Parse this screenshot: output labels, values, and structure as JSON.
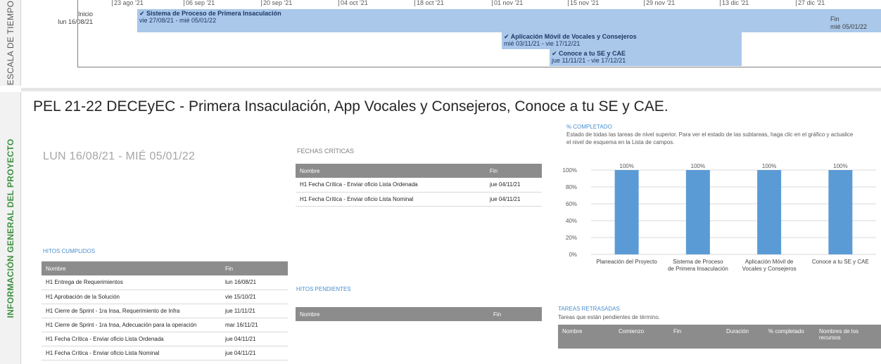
{
  "side_labels": {
    "timescale": "ESCALA DE TIEMPO",
    "info": "INFORMACIÓN GENERAL DEL PROYECTO"
  },
  "timeline": {
    "ticks": [
      "23 ago '21",
      "06 sep '21",
      "20 sep '21",
      "04 oct '21",
      "18 oct '21",
      "01 nov '21",
      "15 nov '21",
      "29 nov '21",
      "13 dic '21",
      "27 dic '21"
    ],
    "start_label": "Inicio",
    "start_date": "lun 16/08/21",
    "end_label": "Fin",
    "end_date": "mié 05/01/22",
    "bars": [
      {
        "title": "✔ Sistema de Proceso de Primera Insaculación",
        "dates": "vie 27/08/21 - mié 05/01/22"
      },
      {
        "title": "✔ Aplicación Móvil de Vocales y Consejeros",
        "dates": "mié 03/11/21 - vie 17/12/21"
      },
      {
        "title": "✔ Conoce a tu SE y CAE",
        "dates": "jue 11/11/21 - vie 17/12/21"
      }
    ]
  },
  "title": "PEL 21-22 DECEyEC - Primera Insaculación, App Vocales y Consejeros, Conoce a tu SE y CAE.",
  "date_range": "LUN 16/08/21 -  MIÉ 05/01/22",
  "fechas_criticas": {
    "label": "FECHAS CRÍTICAS",
    "headers": [
      "Nombre",
      "Fin"
    ],
    "rows": [
      [
        "H1 Fecha Crítica - Enviar oficio Lista Ordenada",
        "jue 04/11/21"
      ],
      [
        "H1 Fecha Crítica - Enviar oficio Lista Nominal",
        "jue 04/11/21"
      ]
    ]
  },
  "hitos_cumplidos": {
    "label": "HITOS CUMPLIDOS",
    "headers": [
      "Nombre",
      "Fin"
    ],
    "rows": [
      [
        "H1 Entrega de Requerimientos",
        "lun 16/08/21"
      ],
      [
        "H1 Aprobación de la Solución",
        "vie 15/10/21"
      ],
      [
        "H1 Cierre de Sprint - 1ra Insa, Requerimiento de Infra",
        "jue 11/11/21"
      ],
      [
        "H1 Cierre de Sprint - 1ra Insa, Adecuación para la operación",
        "mar 16/11/21"
      ],
      [
        "H1 Fecha Crítica - Enviar oficio Lista Ordenada",
        "jue 04/11/21"
      ],
      [
        "H1 Fecha Crítica - Enviar oficio Lista Nominal",
        "jue 04/11/21"
      ]
    ]
  },
  "hitos_pendientes": {
    "label": "HITOS PENDIENTES",
    "headers": [
      "Nombre",
      "Fin"
    ]
  },
  "completado": {
    "label": "% COMPLETADO",
    "description": "Estado de todas las tareas de nivel superior. Para ver el estado de las subtareas, haga clic en el gráfico y actualice el nivel de esquema en la Lista de campos."
  },
  "tareas_retrasadas": {
    "label": "TAREAS RETRASADAS",
    "description": "Tareas que están pendientes de término.",
    "headers": [
      "Nombre",
      "Comienzo",
      "Fin",
      "Duración",
      "% completado",
      "Nombres de los recursos"
    ]
  },
  "colors": {
    "bar": "#5b9bd5",
    "timeline_bar": "#a9c8ea",
    "side_info": "#3d9140"
  },
  "chart_data": {
    "type": "bar",
    "categories": [
      "Planeación del Proyecto",
      "Sistema de Proceso de Primera Insaculación",
      "Aplicación Móvil de Vocales y Consejeros",
      "Conoce a tu SE y CAE"
    ],
    "values": [
      100,
      100,
      100,
      100
    ],
    "data_labels": [
      "100%",
      "100%",
      "100%",
      "100%"
    ],
    "y_ticks": [
      "0%",
      "20%",
      "40%",
      "60%",
      "80%",
      "100%"
    ],
    "ylim": [
      0,
      100
    ],
    "grid": true
  }
}
